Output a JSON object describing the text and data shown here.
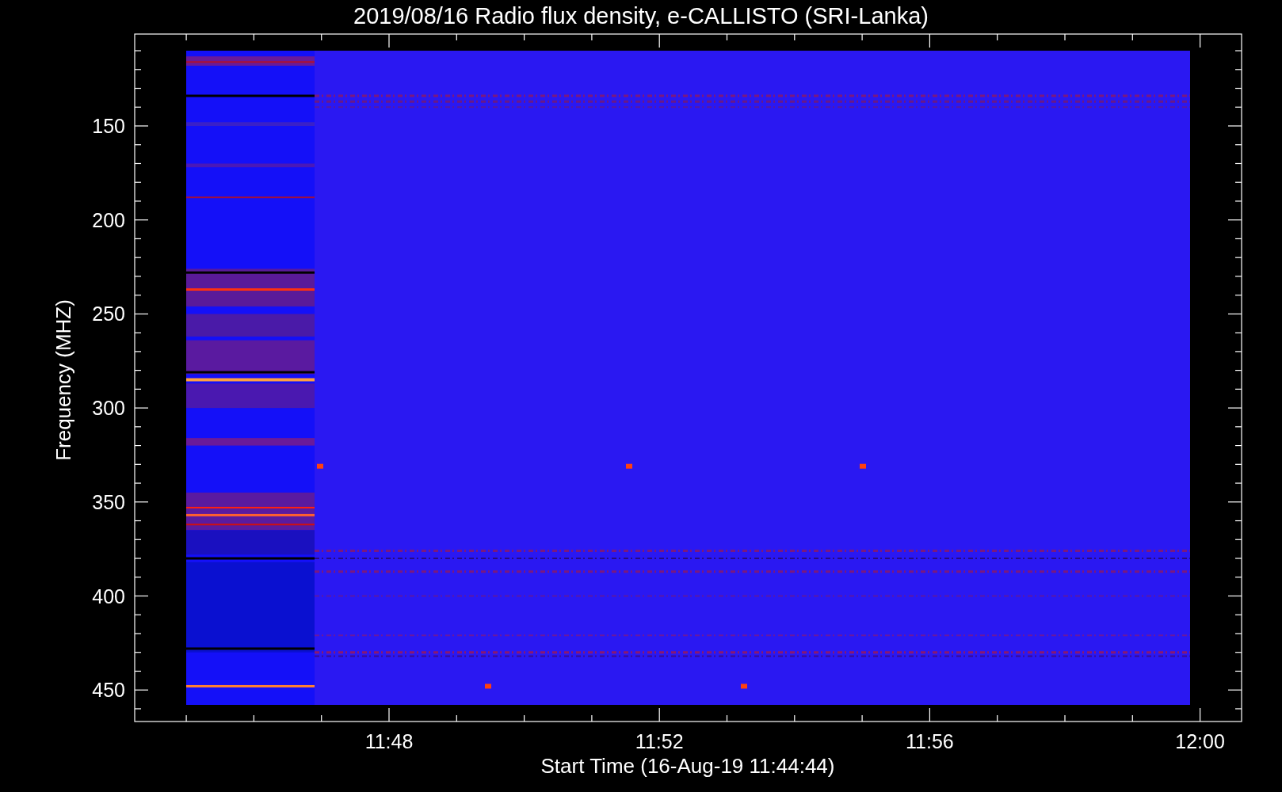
{
  "title": "2019/08/16  Radio flux density, e-CALLISTO (SRI-Lanka)",
  "plot": {
    "ylabel": "Frequency (MHZ)",
    "xlabel": "Start Time (16-Aug-19 11:44:44)",
    "yticks": [
      "150",
      "200",
      "250",
      "300",
      "350",
      "400",
      "450"
    ],
    "xticks": [
      "11:48",
      "11:52",
      "11:56",
      "12:00"
    ]
  }
}
